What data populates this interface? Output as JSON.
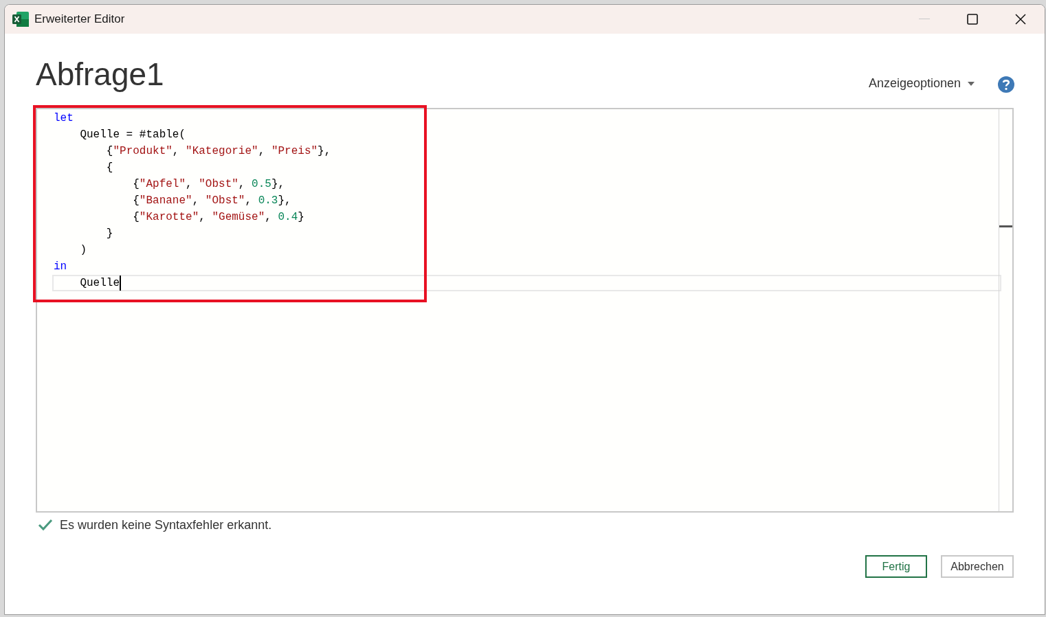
{
  "window": {
    "title": "Erweiterter Editor"
  },
  "query_title": "Abfrage1",
  "display_options": {
    "label": "Anzeigeoptionen"
  },
  "editor": {
    "highlight_box": true,
    "lines": [
      {
        "current": false,
        "tokens": [
          {
            "kind": "keyword",
            "text": "let"
          }
        ]
      },
      {
        "current": false,
        "tokens": [
          {
            "kind": "plain",
            "text": "    Quelle = #table("
          }
        ]
      },
      {
        "current": false,
        "tokens": [
          {
            "kind": "plain",
            "text": "        {"
          },
          {
            "kind": "string",
            "text": "\"Produkt\""
          },
          {
            "kind": "plain",
            "text": ", "
          },
          {
            "kind": "string",
            "text": "\"Kategorie\""
          },
          {
            "kind": "plain",
            "text": ", "
          },
          {
            "kind": "string",
            "text": "\"Preis\""
          },
          {
            "kind": "plain",
            "text": "},"
          }
        ]
      },
      {
        "current": false,
        "tokens": [
          {
            "kind": "plain",
            "text": "        {"
          }
        ]
      },
      {
        "current": false,
        "tokens": [
          {
            "kind": "plain",
            "text": "            {"
          },
          {
            "kind": "string",
            "text": "\"Apfel\""
          },
          {
            "kind": "plain",
            "text": ", "
          },
          {
            "kind": "string",
            "text": "\"Obst\""
          },
          {
            "kind": "plain",
            "text": ", "
          },
          {
            "kind": "number",
            "text": "0.5"
          },
          {
            "kind": "plain",
            "text": "},"
          }
        ]
      },
      {
        "current": false,
        "tokens": [
          {
            "kind": "plain",
            "text": "            {"
          },
          {
            "kind": "string",
            "text": "\"Banane\""
          },
          {
            "kind": "plain",
            "text": ", "
          },
          {
            "kind": "string",
            "text": "\"Obst\""
          },
          {
            "kind": "plain",
            "text": ", "
          },
          {
            "kind": "number",
            "text": "0.3"
          },
          {
            "kind": "plain",
            "text": "},"
          }
        ]
      },
      {
        "current": false,
        "tokens": [
          {
            "kind": "plain",
            "text": "            {"
          },
          {
            "kind": "string",
            "text": "\"Karotte\""
          },
          {
            "kind": "plain",
            "text": ", "
          },
          {
            "kind": "string",
            "text": "\"Gemüse\""
          },
          {
            "kind": "plain",
            "text": ", "
          },
          {
            "kind": "number",
            "text": "0.4"
          },
          {
            "kind": "plain",
            "text": "}"
          }
        ]
      },
      {
        "current": false,
        "tokens": [
          {
            "kind": "plain",
            "text": "        }"
          }
        ]
      },
      {
        "current": false,
        "tokens": [
          {
            "kind": "plain",
            "text": "    )"
          }
        ]
      },
      {
        "current": false,
        "tokens": [
          {
            "kind": "keyword",
            "text": "in"
          }
        ]
      },
      {
        "current": true,
        "tokens": [
          {
            "kind": "plain",
            "text": "    Quelle"
          }
        ]
      }
    ]
  },
  "status": {
    "ok": true,
    "text": "Es wurden keine Syntaxfehler erkannt."
  },
  "buttons": [
    {
      "label": "Fertig",
      "primary": true
    },
    {
      "label": "Abbrechen",
      "primary": false
    }
  ]
}
